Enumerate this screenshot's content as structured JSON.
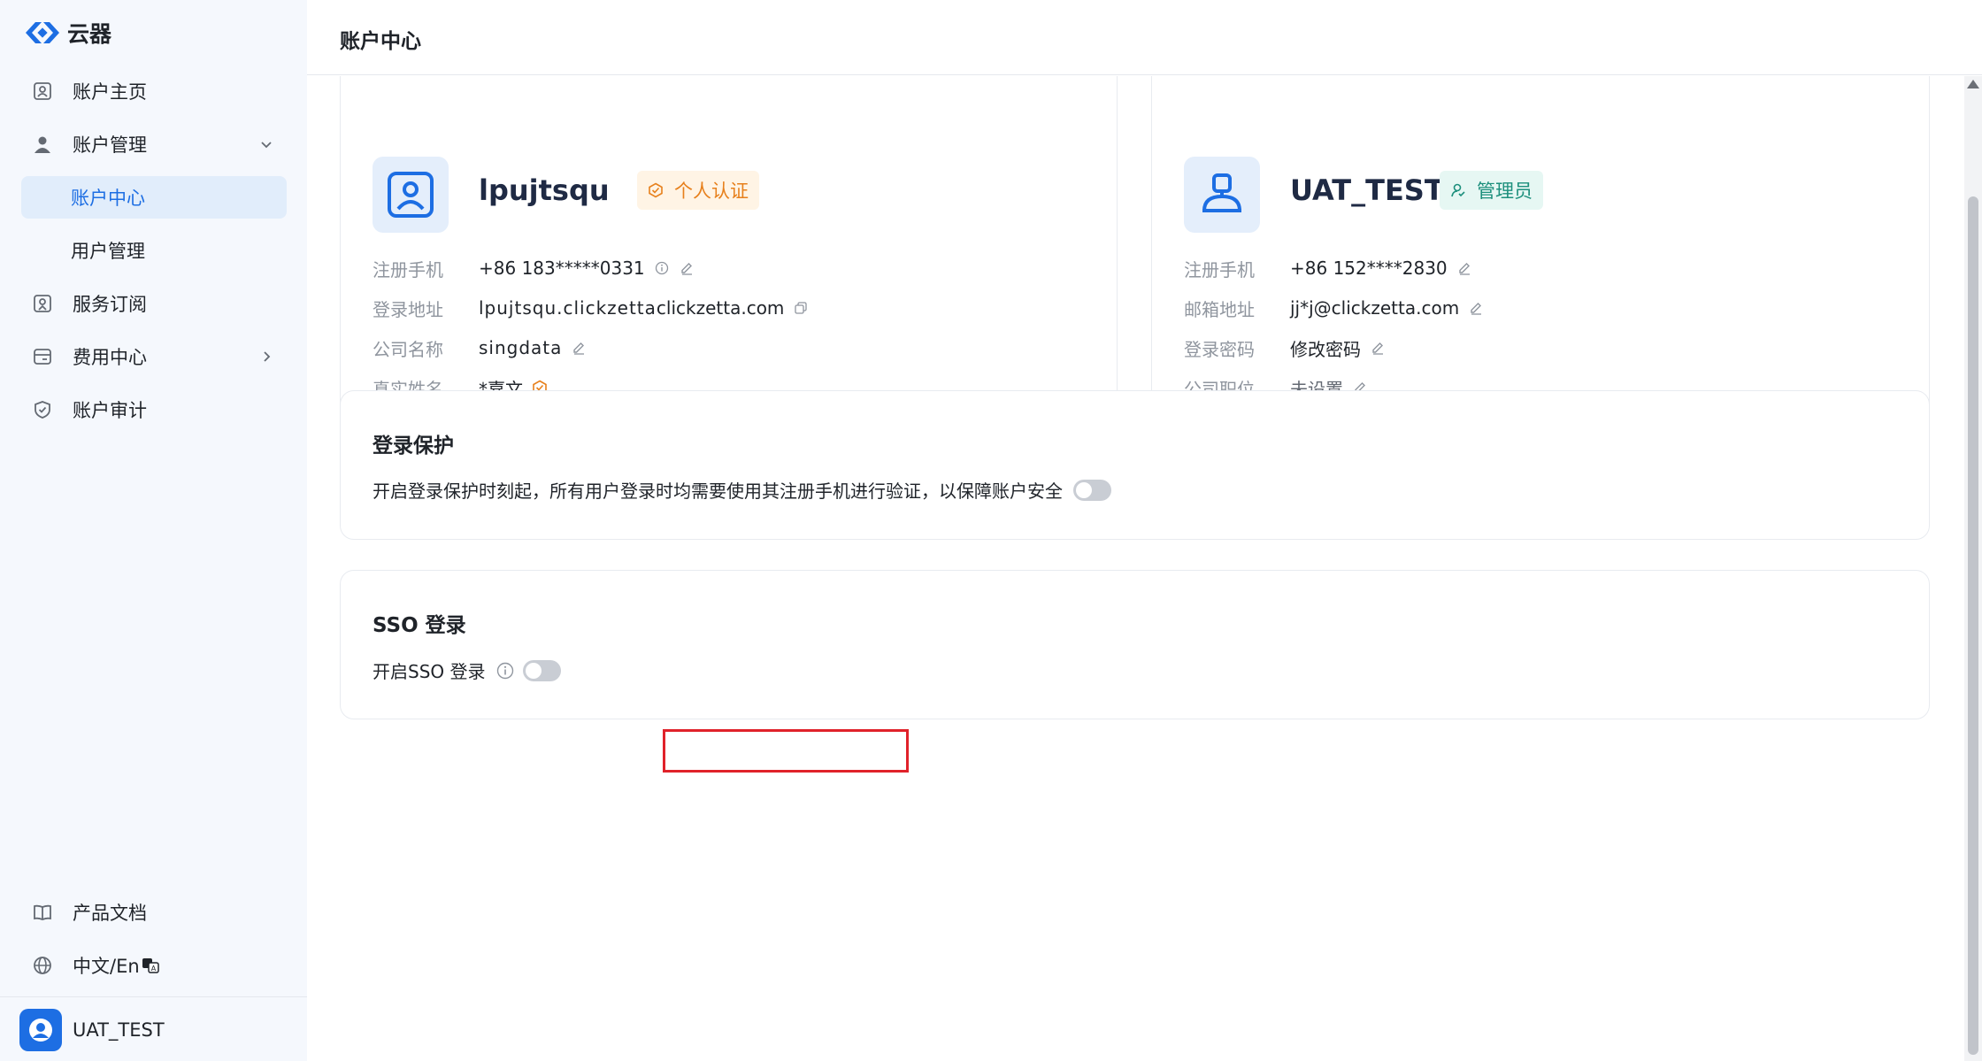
{
  "brand": {
    "name": "云器"
  },
  "sidebar": {
    "items": [
      {
        "label": "账户主页",
        "icon": "account-home-icon"
      },
      {
        "label": "账户管理",
        "icon": "user-icon"
      },
      {
        "label": "服务订阅",
        "icon": "subscription-icon"
      },
      {
        "label": "费用中心",
        "icon": "billing-icon"
      },
      {
        "label": "账户审计",
        "icon": "shield-check-icon"
      }
    ],
    "sub_items": [
      {
        "label": "账户中心",
        "active": true
      },
      {
        "label": "用户管理",
        "active": false
      }
    ],
    "bottom": [
      {
        "label": "产品文档",
        "icon": "book-icon"
      },
      {
        "label": "中文/En",
        "icon": "globe-icon"
      }
    ],
    "user": {
      "name": "UAT_TEST"
    }
  },
  "header": {
    "title": "账户中心"
  },
  "account_card": {
    "name": "lpujtsqu",
    "tag": "个人认证",
    "rows": [
      {
        "label": "注册手机",
        "value": "+86 183*****0331"
      },
      {
        "label": "登录地址",
        "value_hidden": "lpujtsqu.clickzetta",
        "value": "clickzetta.com"
      },
      {
        "label": "公司名称",
        "value": "singdata"
      },
      {
        "label": "真实姓名",
        "value": "*嘉文"
      }
    ]
  },
  "user_card": {
    "name": "UAT_TEST",
    "tag": "管理员",
    "rows": [
      {
        "label": "注册手机",
        "value": "+86 152****2830"
      },
      {
        "label": "邮箱地址",
        "value": "jj*j@clickzetta.com"
      },
      {
        "label": "登录密码",
        "value": "修改密码"
      },
      {
        "label": "公司职位",
        "value": "未设置"
      }
    ]
  },
  "login_protection": {
    "title": "登录保护",
    "description": "开启登录保护时刻起，所有用户登录时均需要使用其注册手机进行验证，以保障账户安全",
    "enabled": false
  },
  "sso": {
    "title": "SSO 登录",
    "label": "开启SSO 登录",
    "enabled": false
  },
  "colors": {
    "accent": "#1d6ee3",
    "highlight": "#e0222a",
    "warning": "#e7801c",
    "teal": "#1c8f7c"
  }
}
